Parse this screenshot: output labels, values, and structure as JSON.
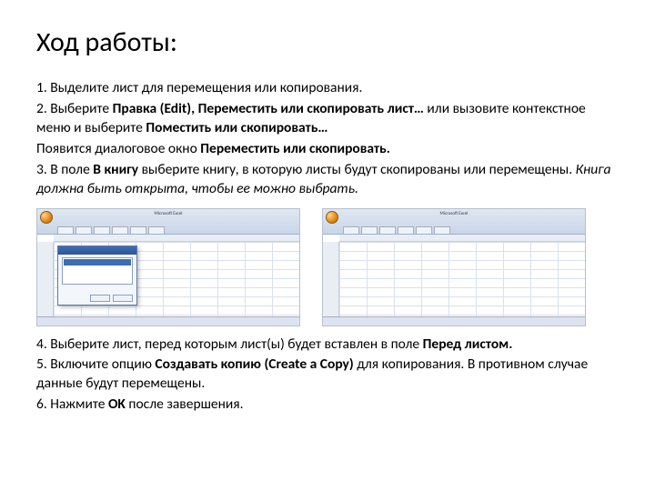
{
  "title": "Ход работы:",
  "p1": {
    "text": "1. Выделите лист для перемещения или копирования."
  },
  "p2": {
    "a": "2. Выберите ",
    "b": "Правка (Edit), Переместить или скопировать лист…",
    "c": " или вызовите контекстное меню и выберите ",
    "d": "Поместить или скопировать…"
  },
  "p3": {
    "a": "Появится диалоговое окно ",
    "b": "Переместить или скопировать."
  },
  "p4": {
    "a": "3. В поле ",
    "b": "В книгу",
    "c": " выберите книгу, в которую листы будут скопированы или перемещены. ",
    "d": "Книга должна быть открыта, чтобы ее можно выбрать."
  },
  "p5": {
    "a": "4. Выберите лист, перед которым лист(ы) будет вставлен в поле ",
    "b": "Перед листом."
  },
  "p6": {
    "a": "5. Включите опцию ",
    "b": "Создавать копию (Create a Copy)",
    "c": " для копирования. В противном случае данные будут перемещены."
  },
  "p7": {
    "a": "6. Нажмите ",
    "b": "OK",
    "c": " после завершения."
  },
  "shot_caption": "Microsoft Excel"
}
